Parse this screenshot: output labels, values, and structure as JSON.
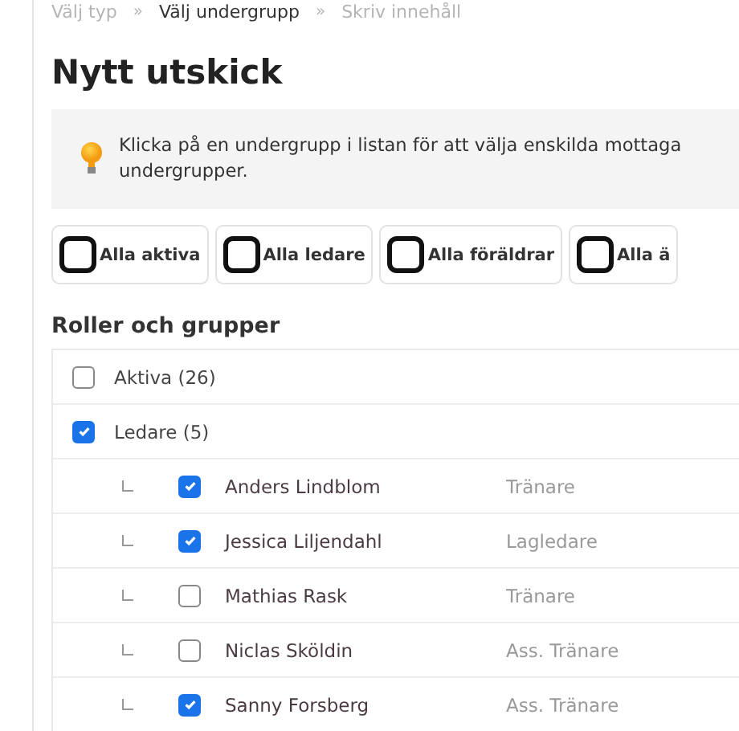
{
  "breadcrumb": [
    {
      "label": "Välj typ",
      "selected": false
    },
    {
      "label": "Välj undergrupp",
      "selected": true
    },
    {
      "label": "Skriv innehåll",
      "selected": false
    }
  ],
  "breadcrumb_separator": "»",
  "title": "Nytt utskick",
  "info": {
    "text": "Klicka på en undergrupp i listan för att välja enskilda mottaga",
    "text_line_2": "undergrupper."
  },
  "quick_buttons": [
    {
      "label": "Alla aktiva",
      "checked": false
    },
    {
      "label": "Alla ledare",
      "checked": false
    },
    {
      "label": "Alla föräldrar",
      "checked": false
    },
    {
      "label": "Alla ä",
      "checked": false
    }
  ],
  "section_title": "Roller och grupper",
  "groups": [
    {
      "label": "Aktiva (26)",
      "checked": false
    },
    {
      "label": "Ledare (5)",
      "checked": true,
      "children": [
        {
          "name": "Anders Lindblom",
          "role": "Tränare",
          "checked": true
        },
        {
          "name": "Jessica Liljendahl",
          "role": "Lagledare",
          "checked": true
        },
        {
          "name": "Mathias Rask",
          "role": "Tränare",
          "checked": false
        },
        {
          "name": "Niclas Sköldin",
          "role": "Ass. Tränare",
          "checked": false
        },
        {
          "name": "Sanny Forsberg",
          "role": "Ass. Tränare",
          "checked": true
        }
      ]
    }
  ]
}
